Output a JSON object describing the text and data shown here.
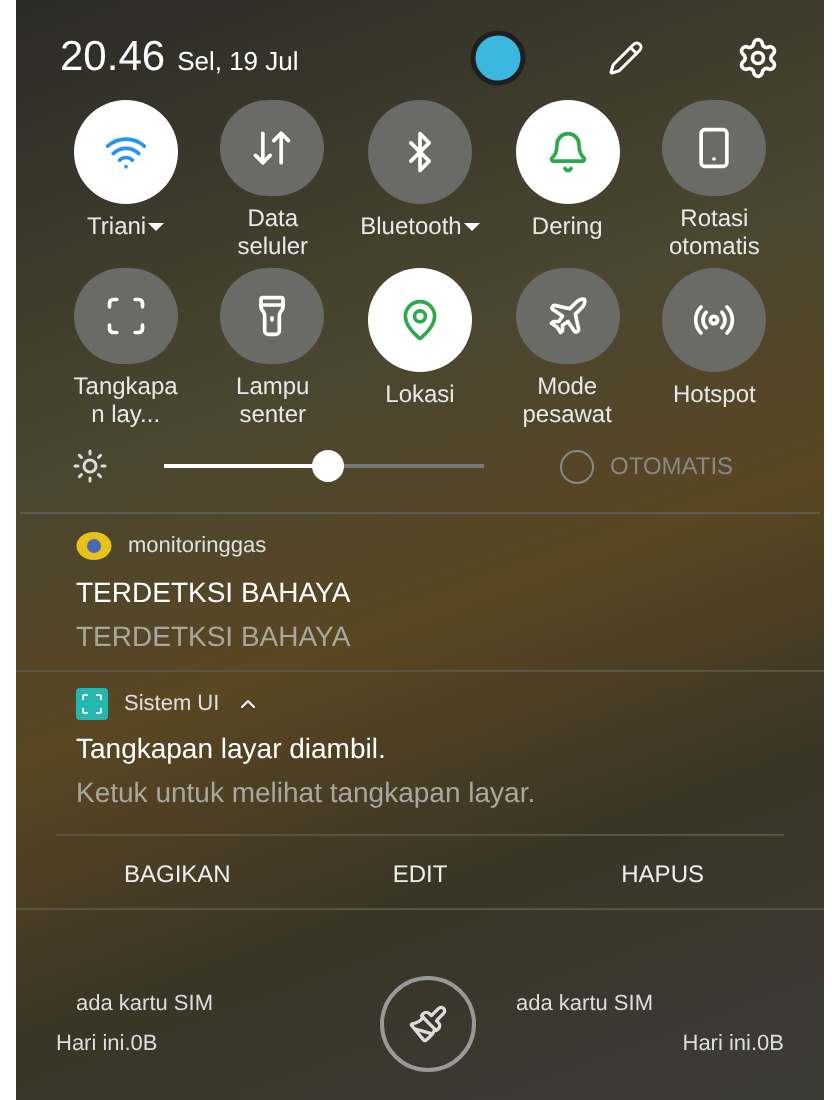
{
  "status": {
    "time": "20.46",
    "date": "Sel, 19 Jul"
  },
  "tiles": [
    {
      "label": "Triani",
      "on": true,
      "dropdown": true
    },
    {
      "label": "Data seluler",
      "on": false,
      "dropdown": false
    },
    {
      "label": "Bluetooth",
      "on": false,
      "dropdown": true
    },
    {
      "label": "Dering",
      "on": true,
      "dropdown": false
    },
    {
      "label": "Rotasi otomatis",
      "on": false,
      "dropdown": false
    },
    {
      "label": "Tangkapan lay...",
      "on": false,
      "dropdown": false
    },
    {
      "label": "Lampu senter",
      "on": false,
      "dropdown": false
    },
    {
      "label": "Lokasi",
      "on": true,
      "dropdown": false
    },
    {
      "label": "Mode pesawat",
      "on": false,
      "dropdown": false
    },
    {
      "label": "Hotspot",
      "on": false,
      "dropdown": false
    }
  ],
  "brightness": {
    "level": 0.51,
    "auto_label": "OTOMATIS",
    "auto_checked": false
  },
  "notifications": [
    {
      "app": "monitoringgas",
      "title": "TERDETKSI BAHAYA",
      "text": "TERDETKSI BAHAYA",
      "expanded": false
    },
    {
      "app": "Sistem UI",
      "title": "Tangkapan layar diambil.",
      "text": "Ketuk untuk melihat tangkapan layar.",
      "expanded": true,
      "actions": [
        "BAGIKAN",
        "EDIT",
        "HAPUS"
      ]
    }
  ],
  "footer": {
    "left": {
      "sim": "ada kartu SIM",
      "usage": "Hari ini.0B"
    },
    "right": {
      "sim": "ada kartu SIM",
      "usage": "Hari ini.0B"
    }
  }
}
